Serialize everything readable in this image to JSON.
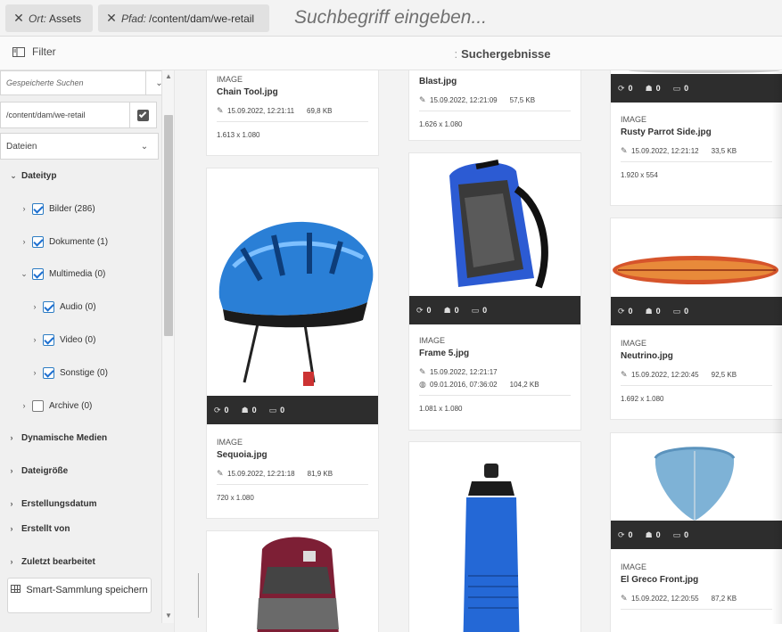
{
  "omnisearch": {
    "tags": [
      {
        "key": "Ort:",
        "value": "Assets"
      },
      {
        "key": "Pfad:",
        "value": "/content/dam/we-retail"
      }
    ],
    "placeholder": "Suchbegriff eingeben..."
  },
  "actionbar": {
    "filter_label": "Filter",
    "title": "Suchergebnisse"
  },
  "rail": {
    "saved_searches_placeholder": "Gespeicherte Suchen",
    "path_value": "/content/dam/we-retail",
    "type_select": "Dateien",
    "tree": [
      {
        "label": "Dateityp",
        "checked": null
      },
      {
        "label": "Bilder (286)",
        "checked": true
      },
      {
        "label": "Dokumente (1)",
        "checked": true
      },
      {
        "label": "Multimedia (0)",
        "checked": true
      },
      {
        "label": "Audio (0)",
        "checked": true
      },
      {
        "label": "Video (0)",
        "checked": true
      },
      {
        "label": "Sonstige (0)",
        "checked": true
      },
      {
        "label": "Archive (0)",
        "checked": false
      }
    ],
    "sections": [
      "Dynamische Medien",
      "Dateigröße",
      "Erstellungsdatum",
      "Erstellt von",
      "Zuletzt bearbeitet"
    ],
    "smart_collection_label": "Smart-Sammlung speichern"
  },
  "cards": [
    {
      "type": "IMAGE",
      "name": "Chain Tool.jpg",
      "date": "15.09.2022, 12:21:11",
      "size": "69,8 KB",
      "dims": "1.613 x 1.080"
    },
    {
      "type": "",
      "name": "Blast.jpg",
      "date": "15.09.2022, 12:21:09",
      "size": "57,5 KB",
      "dims": "1.626 x 1.080"
    },
    {
      "type": "IMAGE",
      "name": "Rusty Parrot Side.jpg",
      "date": "15.09.2022, 12:21:12",
      "size": "33,5 KB",
      "dims": "1.920 x 554",
      "q": [
        "0",
        "0",
        "0"
      ]
    },
    {
      "type": "IMAGE",
      "name": "Sequoia.jpg",
      "date": "15.09.2022, 12:21:18",
      "size": "81,9 KB",
      "dims": "720 x 1.080",
      "q": [
        "0",
        "0",
        "0"
      ]
    },
    {
      "type": "IMAGE",
      "name": "Frame 5.jpg",
      "date": "15.09.2022, 12:21:17",
      "date2": "09.01.2016, 07:36:02",
      "size": "104,2 KB",
      "dims": "1.081 x 1.080",
      "q": [
        "0",
        "0",
        "0"
      ]
    },
    {
      "type": "IMAGE",
      "name": "Neutrino.jpg",
      "date": "15.09.2022, 12:20:45",
      "size": "92,5 KB",
      "dims": "1.692 x 1.080",
      "q": [
        "0",
        "0",
        "0"
      ]
    },
    {
      "type": "IMAGE",
      "name": "El Greco Front.jpg",
      "date": "15.09.2022, 12:20:55",
      "size": "87,2 KB",
      "q": [
        "0",
        "0",
        "0"
      ]
    }
  ],
  "colors": {
    "accent": "#2c7cc3",
    "quickbar": "#2d2d2d"
  }
}
